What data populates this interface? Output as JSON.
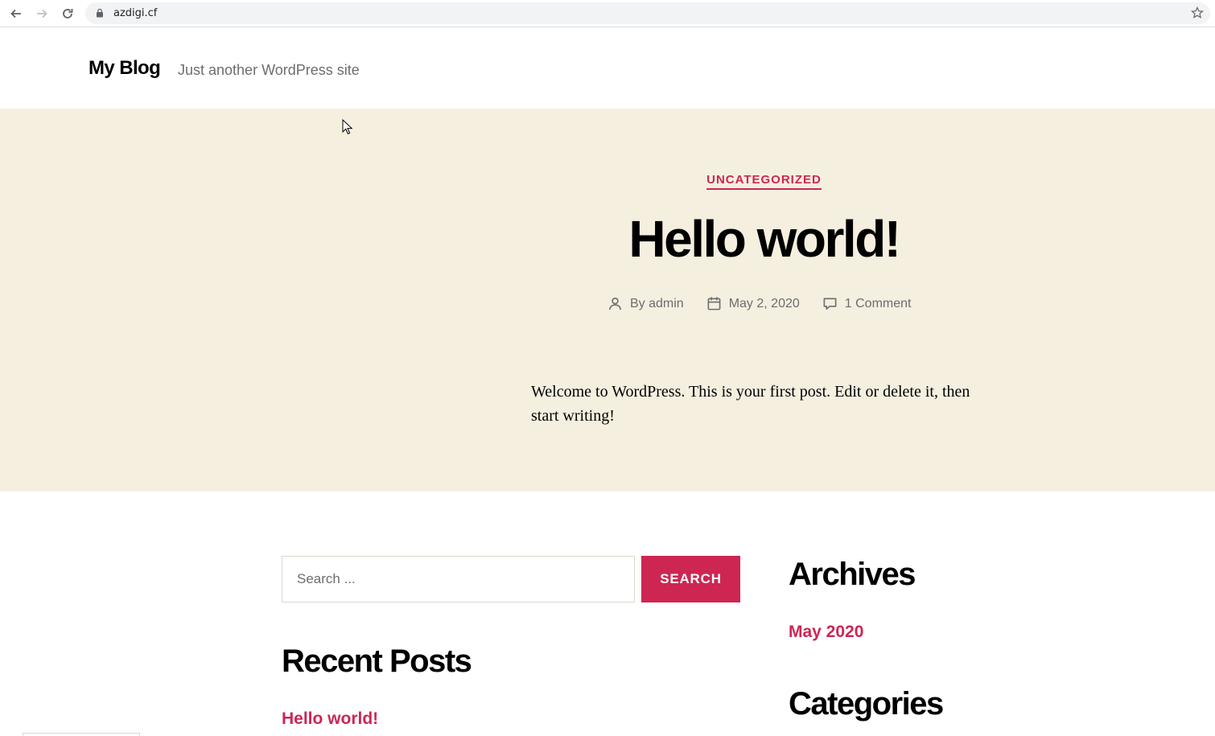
{
  "browser": {
    "url": "azdigi.cf"
  },
  "site": {
    "title": "My Blog",
    "description": "Just another WordPress site"
  },
  "post": {
    "category": "UNCATEGORIZED",
    "title": "Hello world!",
    "author": "By admin",
    "date": "May 2, 2020",
    "comments": "1 Comment",
    "content": "Welcome to WordPress. This is your first post. Edit or delete it, then start writing!"
  },
  "search": {
    "placeholder": "Search ...",
    "button_label": "SEARCH"
  },
  "recent_posts": {
    "heading": "Recent Posts",
    "items": [
      "Hello world!"
    ]
  },
  "archives": {
    "heading": "Archives",
    "items": [
      "May 2020"
    ]
  },
  "categories": {
    "heading": "Categories"
  },
  "colors": {
    "accent": "#cd2653",
    "hero_background": "#f5efe0",
    "secondary_text": "#6d6d6d"
  }
}
